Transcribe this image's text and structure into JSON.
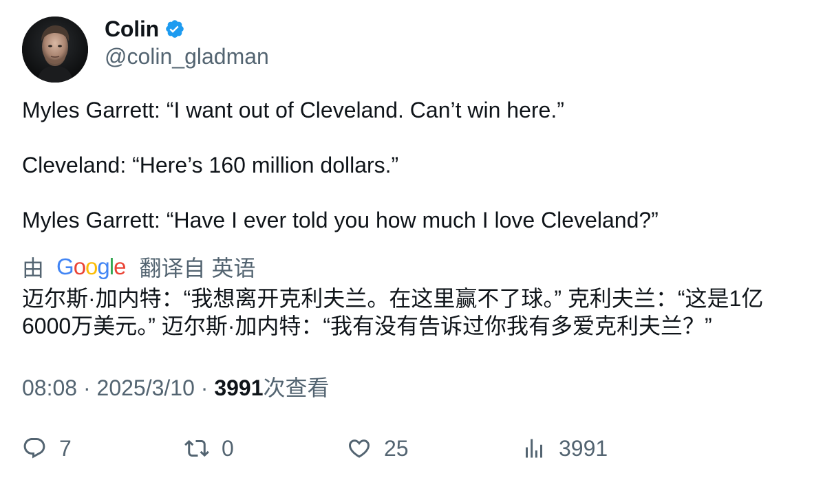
{
  "author": {
    "display_name": "Colin",
    "handle": "@colin_gladman",
    "verified": true
  },
  "tweet": {
    "paragraphs": [
      "Myles Garrett: “I want out of Cleveland. Can’t win here.”",
      "Cleveland: “Here’s 160 million dollars.”",
      "Myles Garrett: “Have I ever told you how much I love Cleveland?”"
    ]
  },
  "translation": {
    "by_label": "由",
    "provider": "Google",
    "from_label": "翻译自 英语",
    "text": "迈尔斯·加内特：“我想离开克利夫兰。在这里赢不了球。” 克利夫兰：“这是1亿6000万美元。” 迈尔斯·加内特：“我有没有告诉过你我有多爱克利夫兰？”"
  },
  "meta": {
    "time": "08:08",
    "separator": " · ",
    "date": "2025/3/10",
    "views_count": "3991",
    "views_label": "次查看"
  },
  "actions": {
    "reply_count": "7",
    "retweet_count": "0",
    "like_count": "25",
    "views_count": "3991"
  },
  "colors": {
    "verified_blue": "#1d9bf0",
    "secondary_text": "#536471",
    "primary_text": "#0f1419"
  },
  "icons": {
    "verified": "verified-badge-icon",
    "reply": "reply-icon",
    "retweet": "retweet-icon",
    "like": "heart-icon",
    "views": "bar-chart-icon"
  }
}
